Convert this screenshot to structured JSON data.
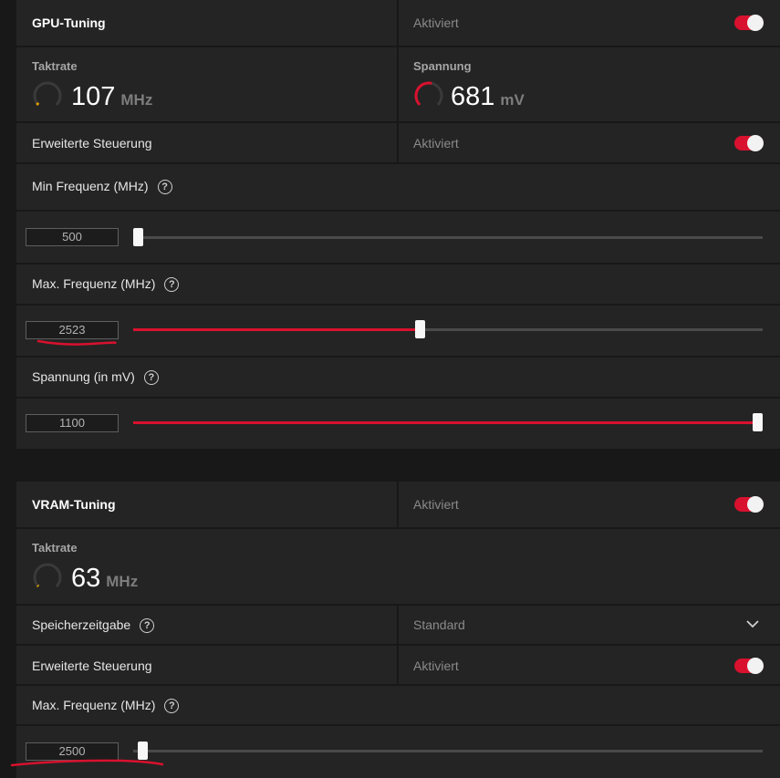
{
  "gpu": {
    "title": "GPU-Tuning",
    "status": "Aktiviert",
    "enabled": true,
    "clock": {
      "label": "Taktrate",
      "value": "107",
      "unit": "MHz",
      "level": 0.04
    },
    "voltage": {
      "label": "Spannung",
      "value": "681",
      "unit": "mV",
      "level": 0.55
    },
    "advanced": {
      "label": "Erweiterte Steuerung",
      "status": "Aktiviert",
      "enabled": true
    },
    "min_freq": {
      "label": "Min Frequenz (MHz)",
      "value": "500",
      "slider_fraction": 0.0
    },
    "max_freq": {
      "label": "Max. Frequenz (MHz)",
      "value": "2523",
      "slider_fraction": 0.455
    },
    "volt_set": {
      "label": "Spannung (in mV)",
      "value": "1100",
      "slider_fraction": 1.0
    }
  },
  "vram": {
    "title": "VRAM-Tuning",
    "status": "Aktiviert",
    "enabled": true,
    "clock": {
      "label": "Taktrate",
      "value": "63",
      "unit": "MHz",
      "level": 0.02
    },
    "timing": {
      "label": "Speicherzeitgabe",
      "value": "Standard"
    },
    "advanced": {
      "label": "Erweiterte Steuerung",
      "status": "Aktiviert",
      "enabled": true
    },
    "max_freq": {
      "label": "Max. Frequenz (MHz)",
      "value": "2500",
      "slider_fraction": 0.0
    }
  },
  "help_glyph": "?",
  "colors": {
    "accent": "#d8112e",
    "panel": "#242424",
    "background": "#181818"
  },
  "icons": {
    "dropdown": "chevron-down-icon",
    "help": "help-icon"
  }
}
